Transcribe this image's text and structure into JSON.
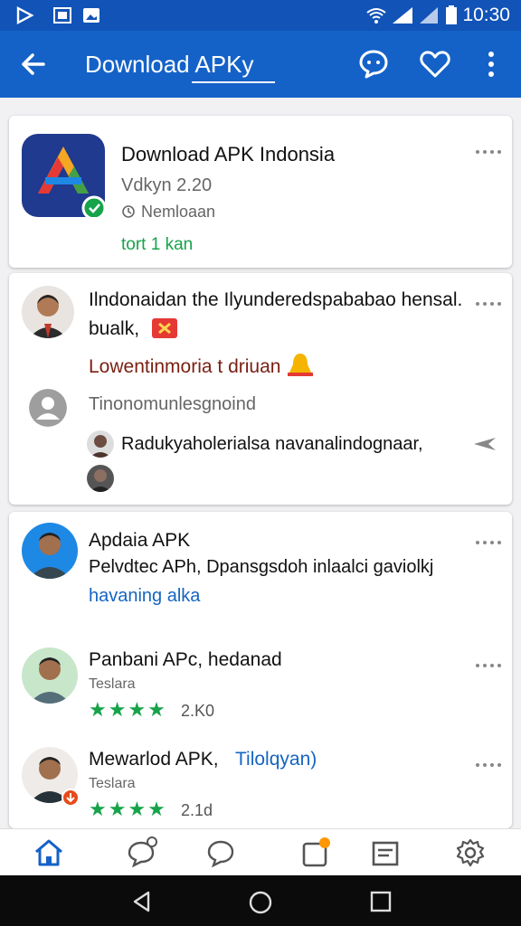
{
  "status_bar": {
    "time": "10:30"
  },
  "app_bar": {
    "title": "Download APKy"
  },
  "app_card": {
    "title": "Download APK Indonsia",
    "version": "Vdkyn 2.20",
    "meta": "Nemloaan",
    "tag": "tort 1 kan"
  },
  "post_card": {
    "headline": "Ilndonaidan the Ilyunderedspababao hensal.",
    "headline2": "bualk,",
    "subtitle": "Lowentinmoria t driuan",
    "comment_prompt": "Tinonomunlesgnoind",
    "reply_text": "Radukyaholerialsa navanalindognaar,"
  },
  "list_items": [
    {
      "title": "Apdaia APK",
      "subtitle": "Pelvdtec APh, Dpansgsdoh inlaalci gaviolkj",
      "link": "havaning alka"
    },
    {
      "title": "Panbani APc, hedanad",
      "sub": "Teslara",
      "count": "2.K0"
    },
    {
      "title": "Mewarlod APK,",
      "title_link": "Tilolqyan)",
      "sub": "Teslara",
      "count": "2.1d"
    }
  ],
  "colors": {
    "primary": "#1462c8",
    "status": "#1253b7",
    "green": "#16a34a"
  }
}
